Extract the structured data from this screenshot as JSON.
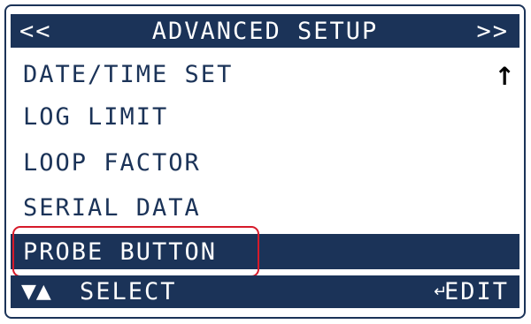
{
  "header": {
    "prev_label": "<<",
    "title": "ADVANCED SETUP",
    "next_label": ">>"
  },
  "menu": {
    "items": [
      {
        "label": "DATE/TIME SET"
      },
      {
        "label": "LOG LIMIT"
      },
      {
        "label": "LOOP FACTOR"
      },
      {
        "label": "SERIAL DATA"
      },
      {
        "label": "PROBE BUTTON",
        "selected": true
      }
    ],
    "scroll_indicator": "↑"
  },
  "footer": {
    "nav_arrows": "▼▲",
    "select_label": "SELECT",
    "enter_icon": "↵",
    "edit_label": "EDIT"
  },
  "colors": {
    "lcd_blue": "#1b3358",
    "highlight_red": "#d61a2a"
  }
}
